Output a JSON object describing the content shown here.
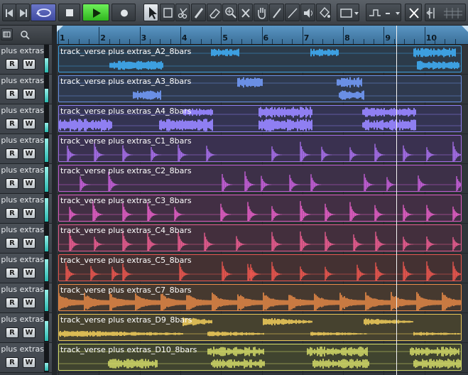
{
  "toolbar": {
    "buttons": [
      {
        "name": "go-to-start-icon"
      },
      {
        "name": "go-to-end-icon"
      },
      {
        "name": "cycle-icon"
      },
      {
        "name": "stop-icon"
      },
      {
        "name": "play-icon"
      },
      {
        "name": "record-icon"
      },
      {
        "name": "object-selection-icon"
      },
      {
        "name": "range-selection-icon"
      },
      {
        "name": "split-scissors-icon"
      },
      {
        "name": "glue-icon"
      },
      {
        "name": "erase-icon"
      },
      {
        "name": "zoom-icon"
      },
      {
        "name": "mute-icon"
      },
      {
        "name": "hand-icon"
      },
      {
        "name": "draw-icon"
      },
      {
        "name": "line-icon"
      },
      {
        "name": "speaker-icon"
      },
      {
        "name": "color-icon"
      },
      {
        "name": "window-layout-icon"
      },
      {
        "name": "snap-type-icon"
      },
      {
        "name": "snap-icon"
      },
      {
        "name": "grid-icon"
      }
    ]
  },
  "ruler": {
    "bars": [
      "1",
      "2",
      "3",
      "4",
      "5",
      "6",
      "7",
      "8",
      "9",
      "10"
    ]
  },
  "tracks": [
    {
      "name": "verse plus extras",
      "event": "track_verse plus extras_A2_8bars",
      "color": "#3d9fe0",
      "bg": "#2c3b4a",
      "meter": 0.55
    },
    {
      "name": "verse plus extras",
      "event": "track_verse plus extras_A3_8bars",
      "color": "#6a8fe4",
      "bg": "#2f3a4f",
      "meter": 0.5
    },
    {
      "name": "verse plus extras",
      "event": "track_verse plus extras_A4_8bars",
      "color": "#8f7ff2",
      "bg": "#343452",
      "meter": 0.35
    },
    {
      "name": "verse plus extras",
      "event": "track_verse plus extras_C1_8bars",
      "color": "#a46de6",
      "bg": "#3a3150",
      "meter": 0.9
    },
    {
      "name": "verse plus extras",
      "event": "track_verse plus extras_C2_8bars",
      "color": "#c15ed4",
      "bg": "#3d3048",
      "meter": 0.95
    },
    {
      "name": "verse plus extras",
      "event": "track_verse plus extras_C3_8bars",
      "color": "#dd5cc0",
      "bg": "#422f44",
      "meter": 0.9
    },
    {
      "name": "verse plus extras",
      "event": "track_verse plus extras_C4_8bars",
      "color": "#e35b8d",
      "bg": "#432f3d",
      "meter": 0.6
    },
    {
      "name": "verse plus extras",
      "event": "track_verse plus extras_C5_8bars",
      "color": "#e6554e",
      "bg": "#443132",
      "meter": 0.85
    },
    {
      "name": "verse plus extras",
      "event": "track_verse plus extras_C7_8bars",
      "color": "#ea8a47",
      "bg": "#46392f",
      "meter": 0.8
    },
    {
      "name": "verse plus extras",
      "event": "track_verse plus extras_D9_8bars",
      "color": "#e8c658",
      "bg": "#46422f",
      "meter": 0.75
    },
    {
      "name": "verse plus extras",
      "event": "track_verse plus extras_D10_8bars",
      "color": "#d8e06a",
      "bg": "#40442f",
      "meter": 0.3
    }
  ],
  "buttons": {
    "read_label": "R",
    "write_label": "W"
  }
}
